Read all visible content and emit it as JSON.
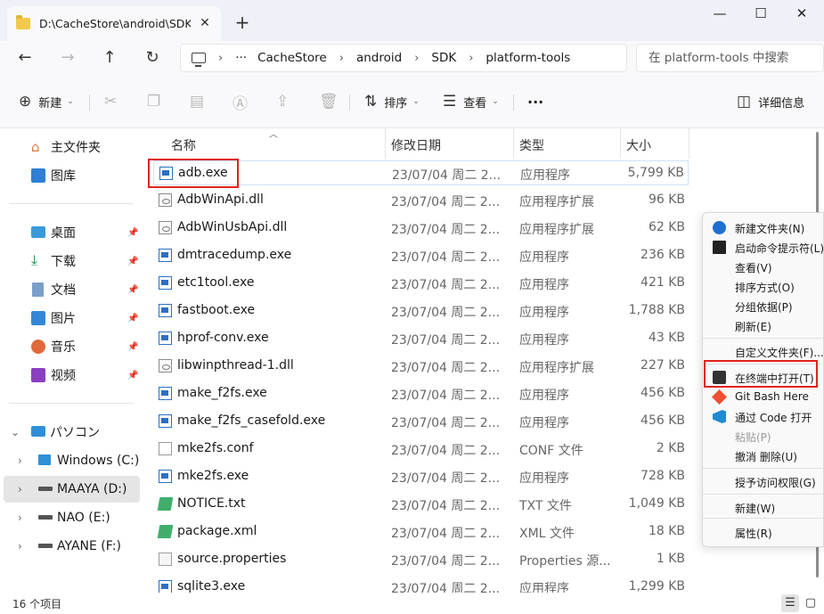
{
  "window": {
    "tab_title": "D:\\CacheStore\\android\\SDK\\p",
    "tab_close": "✕",
    "new_tab": "+",
    "minimize": "—",
    "maximize": "☐",
    "close": "✕"
  },
  "nav": {
    "back": "←",
    "forward": "→",
    "up": "↑",
    "refresh": "↻",
    "more_crumbs": "···",
    "breadcrumbs": [
      "CacheStore",
      "android",
      "SDK",
      "platform-tools"
    ],
    "sep": "›",
    "search_placeholder": "在 platform-tools 中搜索"
  },
  "toolbar": {
    "new_label": "新建",
    "sort_label": "排序",
    "view_label": "查看",
    "more": "···",
    "details_label": "详细信息"
  },
  "sidebar": {
    "home": "主文件夹",
    "gallery": "图库",
    "quick": [
      "桌面",
      "下载",
      "文档",
      "图片",
      "音乐",
      "视频"
    ],
    "this_pc": "パソコン",
    "drives": [
      "Windows (C:)",
      "MAAYA (D:)",
      "NAO (E:)",
      "AYANE (F:)"
    ]
  },
  "columns": {
    "name": "名称",
    "date": "修改日期",
    "type": "类型",
    "size": "大小"
  },
  "files": [
    {
      "name": "adb.exe",
      "date": "23/07/04 周二 2...",
      "type": "应用程序",
      "size": "5,799 KB",
      "icon": "exe"
    },
    {
      "name": "AdbWinApi.dll",
      "date": "23/07/04 周二 2...",
      "type": "应用程序扩展",
      "size": "96 KB",
      "icon": "dll"
    },
    {
      "name": "AdbWinUsbApi.dll",
      "date": "23/07/04 周二 2...",
      "type": "应用程序扩展",
      "size": "62 KB",
      "icon": "dll"
    },
    {
      "name": "dmtracedump.exe",
      "date": "23/07/04 周二 2...",
      "type": "应用程序",
      "size": "236 KB",
      "icon": "exe"
    },
    {
      "name": "etc1tool.exe",
      "date": "23/07/04 周二 2...",
      "type": "应用程序",
      "size": "421 KB",
      "icon": "exe"
    },
    {
      "name": "fastboot.exe",
      "date": "23/07/04 周二 2...",
      "type": "应用程序",
      "size": "1,788 KB",
      "icon": "exe"
    },
    {
      "name": "hprof-conv.exe",
      "date": "23/07/04 周二 2...",
      "type": "应用程序",
      "size": "43 KB",
      "icon": "exe"
    },
    {
      "name": "libwinpthread-1.dll",
      "date": "23/07/04 周二 2...",
      "type": "应用程序扩展",
      "size": "227 KB",
      "icon": "dll"
    },
    {
      "name": "make_f2fs.exe",
      "date": "23/07/04 周二 2...",
      "type": "应用程序",
      "size": "456 KB",
      "icon": "exe"
    },
    {
      "name": "make_f2fs_casefold.exe",
      "date": "23/07/04 周二 2...",
      "type": "应用程序",
      "size": "456 KB",
      "icon": "exe"
    },
    {
      "name": "mke2fs.conf",
      "date": "23/07/04 周二 2...",
      "type": "CONF 文件",
      "size": "2 KB",
      "icon": "doc"
    },
    {
      "name": "mke2fs.exe",
      "date": "23/07/04 周二 2...",
      "type": "应用程序",
      "size": "728 KB",
      "icon": "exe"
    },
    {
      "name": "NOTICE.txt",
      "date": "23/07/04 周二 2...",
      "type": "TXT 文件",
      "size": "1,049 KB",
      "icon": "txt"
    },
    {
      "name": "package.xml",
      "date": "23/07/04 周二 2...",
      "type": "XML 文件",
      "size": "18 KB",
      "icon": "txt"
    },
    {
      "name": "source.properties",
      "date": "23/07/04 周二 2...",
      "type": "Properties 源...",
      "size": "1 KB",
      "icon": "prop"
    },
    {
      "name": "sqlite3.exe",
      "date": "23/07/04 周二 2...",
      "type": "应用程序",
      "size": "1,299 KB",
      "icon": "exe"
    }
  ],
  "status": {
    "count": "16 个项目"
  },
  "context_menu": {
    "items": [
      {
        "label": "新建文件夹(N)",
        "icon": "new-folder-icon"
      },
      {
        "label": "启动命令提示符(L)",
        "icon": "cmd-icon"
      },
      {
        "label": "查看(V)"
      },
      {
        "label": "排序方式(O)"
      },
      {
        "label": "分组依据(P)"
      },
      {
        "label": "刷新(E)"
      },
      {
        "label": "自定义文件夹(F)..."
      },
      {
        "label": "在终端中打开(T)",
        "icon": "terminal-icon"
      },
      {
        "label": "Git Bash Here",
        "icon": "git-bash-icon"
      },
      {
        "label": "通过 Code 打开",
        "icon": "vscode-icon"
      },
      {
        "label": "粘贴(P)",
        "disabled": true
      },
      {
        "label": "撤消 删除(U)"
      },
      {
        "label": "授予访问权限(G)"
      },
      {
        "label": "新建(W)"
      },
      {
        "label": "属性(R)"
      }
    ]
  },
  "colors": {
    "accent": "#0067c0",
    "highlight_box": "#e0231c",
    "selection": "#e5e5e5"
  }
}
